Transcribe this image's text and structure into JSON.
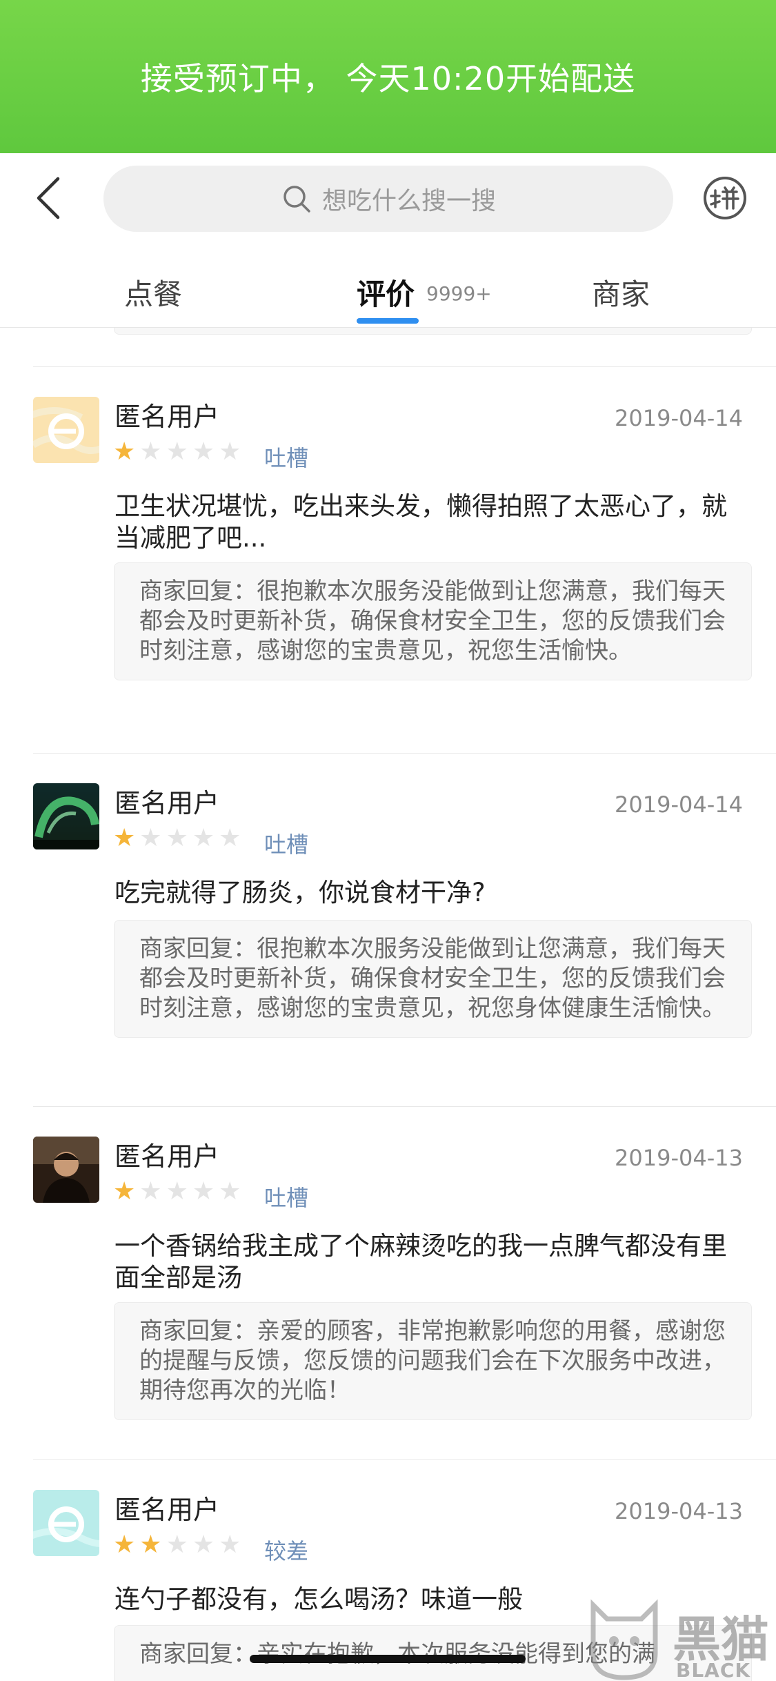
{
  "banner": {
    "text": "接受预订中， 今天10:20开始配送",
    "color": "#6ccf44"
  },
  "search": {
    "placeholder": "想吃什么搜一搜"
  },
  "tabs": [
    {
      "label": "点餐"
    },
    {
      "label": "评价",
      "count": "9999+",
      "active": true
    },
    {
      "label": "商家"
    }
  ],
  "reviews": [
    {
      "user": "匿名用户",
      "date": "2019-04-14",
      "rating": 1,
      "rating_label": "吐槽",
      "content": "卫生状况堪忧，吃出来头发，懒得拍照了太恶心了，就当减肥了吧...",
      "reply": "商家回复：很抱歉本次服务没能做到让您满意，我们每天都会及时更新补货，确保食材安全卫生，您的反馈我们会时刻注意，感谢您的宝贵意见，祝您生活愉快。"
    },
    {
      "user": "匿名用户",
      "date": "2019-04-14",
      "rating": 1,
      "rating_label": "吐槽",
      "content": "吃完就得了肠炎，你说食材干净?",
      "reply": "商家回复：很抱歉本次服务没能做到让您满意，我们每天都会及时更新补货，确保食材安全卫生，您的反馈我们会时刻注意，感谢您的宝贵意见，祝您身体健康生活愉快。"
    },
    {
      "user": "匿名用户",
      "date": "2019-04-13",
      "rating": 1,
      "rating_label": "吐槽",
      "content": "一个香锅给我主成了个麻辣烫吃的我一点脾气都没有里面全部是汤",
      "reply": "商家回复：亲爱的顾客，非常抱歉影响您的用餐，感谢您的提醒与反馈，您反馈的问题我们会在下次服务中改进，期待您再次的光临！"
    },
    {
      "user": "匿名用户",
      "date": "2019-04-13",
      "rating": 2,
      "rating_label": "较差",
      "content": "连勺子都没有，怎么喝汤？味道一般",
      "reply": "商家回复：亲实在抱歉，本次服务没能得到您的满"
    }
  ],
  "watermark": {
    "brand": "黑猫",
    "sub": "BLACK CAT"
  }
}
